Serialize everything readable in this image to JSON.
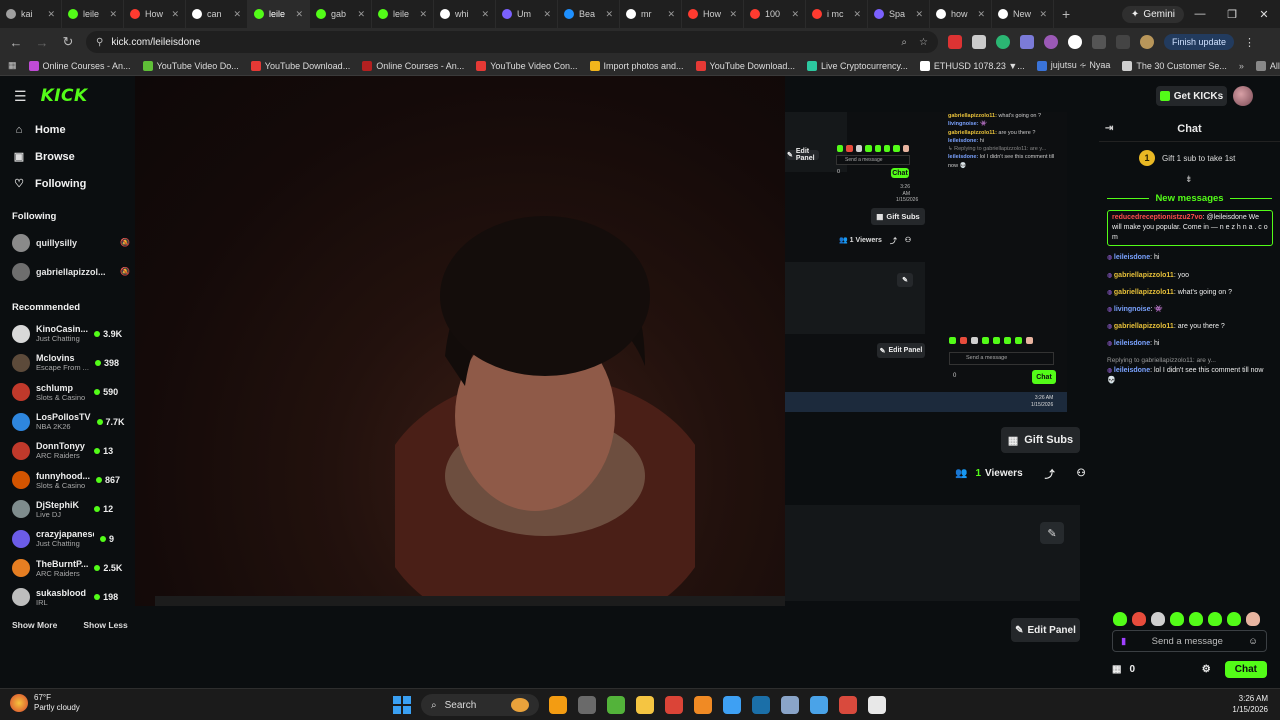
{
  "browser": {
    "tabs": [
      {
        "label": "kai",
        "color": "#a0a0a0"
      },
      {
        "label": "leile",
        "color": "#53fc18"
      },
      {
        "label": "How",
        "color": "#ff3b30"
      },
      {
        "label": "can",
        "color": "#ffffff"
      },
      {
        "label": "leile",
        "color": "#53fc18",
        "active": true
      },
      {
        "label": "gab",
        "color": "#53fc18"
      },
      {
        "label": "leile",
        "color": "#53fc18"
      },
      {
        "label": "whi",
        "color": "#ffffff"
      },
      {
        "label": "Um",
        "color": "#7b61ff"
      },
      {
        "label": "Bea",
        "color": "#1e90ff"
      },
      {
        "label": "mr",
        "color": "#ffffff"
      },
      {
        "label": "How",
        "color": "#ff3b30"
      },
      {
        "label": "100",
        "color": "#ff3b30"
      },
      {
        "label": "i mc",
        "color": "#ff3b30"
      },
      {
        "label": "Spa",
        "color": "#7b61ff"
      },
      {
        "label": "how",
        "color": "#ffffff"
      },
      {
        "label": "New",
        "color": "#ffffff"
      }
    ],
    "new_tab": "+",
    "gemini_label": "Gemini",
    "url": "kick.com/leileisdone",
    "finish_update": "Finish update",
    "bookmarks": [
      {
        "label": "Online Courses - An...",
        "color": "#c04bd6"
      },
      {
        "label": "YouTube Video Do...",
        "color": "#5fbf37"
      },
      {
        "label": "YouTube Download...",
        "color": "#e53935"
      },
      {
        "label": "Online Courses - An...",
        "color": "#b32020"
      },
      {
        "label": "YouTube Video Con...",
        "color": "#e53935"
      },
      {
        "label": "Import photos and...",
        "color": "#f2b51c"
      },
      {
        "label": "YouTube Download...",
        "color": "#e53935"
      },
      {
        "label": "Live Cryptocurrency...",
        "color": "#2cc8a0"
      },
      {
        "label": "ETHUSD 1078.23 ▼...",
        "color": "#ffffff"
      },
      {
        "label": "jujutsu ∻ Nyaa",
        "color": "#3a73d8"
      },
      {
        "label": "The 30 Customer Se...",
        "color": "#cfcfcf"
      }
    ],
    "all_bookmarks": "All Bookmarks"
  },
  "kick": {
    "logo": "KICK",
    "get_kicks": "Get KICKs",
    "nav": [
      {
        "label": "Home",
        "icon": "home-icon",
        "glyph": "⌂"
      },
      {
        "label": "Browse",
        "icon": "browse-icon",
        "glyph": "▣"
      },
      {
        "label": "Following",
        "icon": "heart-icon",
        "glyph": "♡"
      }
    ],
    "following_title": "Following",
    "following": [
      {
        "name": "quillysilly",
        "color": "#8a8a8a"
      },
      {
        "name": "gabriellapizzol...",
        "color": "#6e6e6e"
      }
    ],
    "recommended_title": "Recommended",
    "recommended": [
      {
        "name": "KinoCasin...",
        "category": "Just Chatting",
        "viewers": "3.9K",
        "color": "#d8d8d8"
      },
      {
        "name": "Mclovins",
        "category": "Escape From ...",
        "viewers": "398",
        "color": "#5c4a3a"
      },
      {
        "name": "schlump",
        "category": "Slots & Casino",
        "viewers": "590",
        "color": "#c0392b"
      },
      {
        "name": "LosPollosTV",
        "category": "NBA 2K26",
        "viewers": "7.7K",
        "color": "#2e86de"
      },
      {
        "name": "DonnTonyy",
        "category": "ARC Raiders",
        "viewers": "13",
        "color": "#c0392b"
      },
      {
        "name": "funnyhood...",
        "category": "Slots & Casino",
        "viewers": "867",
        "color": "#d35400"
      },
      {
        "name": "DjStephiK",
        "category": "Live DJ",
        "viewers": "12",
        "color": "#7f8c8d"
      },
      {
        "name": "crazyjapanese",
        "category": "Just Chatting",
        "viewers": "9",
        "color": "#6c5ce7"
      },
      {
        "name": "TheBurntP...",
        "category": "ARC Raiders",
        "viewers": "2.5K",
        "color": "#e67e22"
      },
      {
        "name": "sukasblood",
        "category": "IRL",
        "viewers": "198",
        "color": "#bdbdbd"
      }
    ],
    "show_more": "Show More",
    "show_less": "Show Less",
    "gift_subs": "Gift Subs",
    "viewers_count": "1",
    "viewers_label": "Viewers",
    "edit_panel": "Edit Panel",
    "mirror": {
      "edit_panel": "Edit Panel",
      "send_placeholder": "Send a message",
      "chat_button": "Chat",
      "count": "0",
      "time": "3:26 AM",
      "date": "1/15/2026"
    },
    "chat": {
      "title": "Chat",
      "gift_prompt": "Gift 1 sub to take 1st",
      "new_messages": "New messages",
      "messages": [
        {
          "user": "reducedreceptionistzu27vo",
          "color": "#ff4d4d",
          "text": "@leileisdone We will make you popular. Come in — n e z h n a . c o m",
          "highlight": true
        },
        {
          "user": "leileisdone",
          "color": "#7aa2ff",
          "text": "hi"
        },
        {
          "user": "gabriellapizzolo11",
          "color": "#e8c13a",
          "text": "yoo"
        },
        {
          "user": "gabriellapizzolo11",
          "color": "#e8c13a",
          "text": "what's going on ?"
        },
        {
          "user": "livingnoise",
          "color": "#7aa2ff",
          "text": "👾"
        },
        {
          "user": "gabriellapizzolo11",
          "color": "#e8c13a",
          "text": "are you there ?"
        },
        {
          "user": "leileisdone",
          "color": "#7aa2ff",
          "text": "hi"
        },
        {
          "user": "leileisdone",
          "color": "#7aa2ff",
          "text": "lol I didn't see this comment till now 💀",
          "reply": "Replying to gabriellapizzolo11: are y..."
        }
      ],
      "emote_colors": [
        "#53fc18",
        "#e74c3c",
        "#cfcfcf",
        "#53fc18",
        "#53fc18",
        "#53fc18",
        "#53fc18",
        "#e8b4a0"
      ],
      "send_placeholder": "Send a message",
      "count": "0",
      "chat_button": "Chat"
    }
  },
  "taskbar": {
    "temp": "67°F",
    "condition": "Partly cloudy",
    "search": "Search",
    "time": "3:26 AM",
    "date": "1/15/2026",
    "icons": [
      {
        "name": "food-icon",
        "color": "#f39c12"
      },
      {
        "name": "window-icon",
        "color": "#6a6a6a"
      },
      {
        "name": "xbox-icon",
        "color": "#53b33a"
      },
      {
        "name": "folder-icon",
        "color": "#f5c542"
      },
      {
        "name": "chrome-icon",
        "color": "#db4437"
      },
      {
        "name": "blender-icon",
        "color": "#f08a24"
      },
      {
        "name": "app-icon",
        "color": "#3ea0f3"
      },
      {
        "name": "steam-icon",
        "color": "#1b6fa8"
      },
      {
        "name": "settings-icon",
        "color": "#8aa4c8"
      },
      {
        "name": "store-icon",
        "color": "#4aa3e8"
      },
      {
        "name": "media-icon",
        "color": "#d94a3d"
      },
      {
        "name": "play-icon",
        "color": "#e8e8e8"
      }
    ]
  }
}
